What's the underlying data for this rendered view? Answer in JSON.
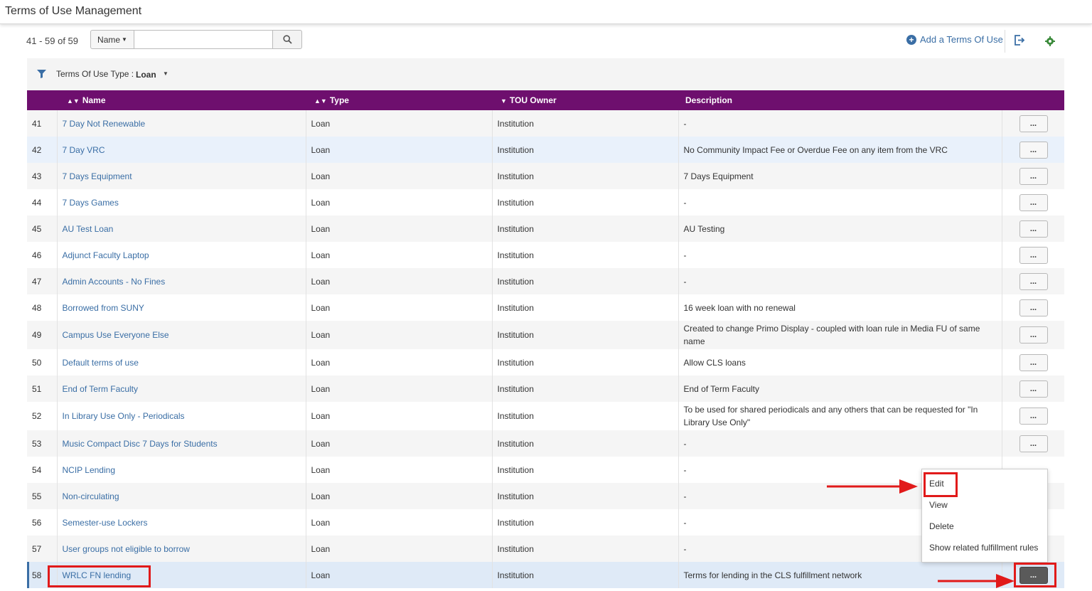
{
  "header": {
    "title": "Terms of Use Management"
  },
  "toolbar": {
    "count": "41 - 59 of 59",
    "scope_label": "Name",
    "search_value": "",
    "add_label": "Add a Terms Of Use"
  },
  "filter": {
    "label": "Terms Of Use Type :",
    "value": "Loan"
  },
  "columns": {
    "name": "Name",
    "type": "Type",
    "owner": "TOU Owner",
    "description": "Description"
  },
  "rows": [
    {
      "num": "41",
      "name": "7 Day Not Renewable",
      "type": "Loan",
      "owner": "Institution",
      "desc": "-"
    },
    {
      "num": "42",
      "name": "7 Day VRC",
      "type": "Loan",
      "owner": "Institution",
      "desc": "No Community Impact Fee or Overdue Fee on any item from the VRC"
    },
    {
      "num": "43",
      "name": "7 Days Equipment",
      "type": "Loan",
      "owner": "Institution",
      "desc": "7 Days Equipment"
    },
    {
      "num": "44",
      "name": "7 Days Games",
      "type": "Loan",
      "owner": "Institution",
      "desc": "-"
    },
    {
      "num": "45",
      "name": "AU Test Loan",
      "type": "Loan",
      "owner": "Institution",
      "desc": "AU Testing"
    },
    {
      "num": "46",
      "name": "Adjunct Faculty Laptop",
      "type": "Loan",
      "owner": "Institution",
      "desc": "-"
    },
    {
      "num": "47",
      "name": "Admin Accounts - No Fines",
      "type": "Loan",
      "owner": "Institution",
      "desc": "-"
    },
    {
      "num": "48",
      "name": "Borrowed from SUNY",
      "type": "Loan",
      "owner": "Institution",
      "desc": "16 week loan with no renewal"
    },
    {
      "num": "49",
      "name": "Campus Use Everyone Else",
      "type": "Loan",
      "owner": "Institution",
      "desc": "Created to change Primo Display - coupled with loan rule in Media FU of same name"
    },
    {
      "num": "50",
      "name": "Default terms of use",
      "type": "Loan",
      "owner": "Institution",
      "desc": "Allow CLS loans"
    },
    {
      "num": "51",
      "name": "End of Term Faculty",
      "type": "Loan",
      "owner": "Institution",
      "desc": "End of Term Faculty"
    },
    {
      "num": "52",
      "name": "In Library Use Only - Periodicals",
      "type": "Loan",
      "owner": "Institution",
      "desc": "To be used for shared periodicals and any others that can be requested for \"In Library Use Only\""
    },
    {
      "num": "53",
      "name": "Music Compact Disc 7 Days for Students",
      "type": "Loan",
      "owner": "Institution",
      "desc": "-"
    },
    {
      "num": "54",
      "name": "NCIP Lending",
      "type": "Loan",
      "owner": "Institution",
      "desc": "-"
    },
    {
      "num": "55",
      "name": "Non-circulating",
      "type": "Loan",
      "owner": "Institution",
      "desc": "-"
    },
    {
      "num": "56",
      "name": "Semester-use Lockers",
      "type": "Loan",
      "owner": "Institution",
      "desc": "-"
    },
    {
      "num": "57",
      "name": "User groups not eligible to borrow",
      "type": "Loan",
      "owner": "Institution",
      "desc": "-"
    },
    {
      "num": "58",
      "name": "WRLC FN lending",
      "type": "Loan",
      "owner": "Institution",
      "desc": "Terms for lending in the CLS fulfillment network"
    }
  ],
  "actions_label": "...",
  "row_menu": {
    "items": [
      "Edit",
      "View",
      "Delete",
      "Show related fulfillment rules"
    ]
  },
  "colors": {
    "header_bg": "#6e0f6e",
    "link": "#3a6ea5",
    "annotation": "#e11a1a"
  },
  "icons": [
    "search-icon",
    "plus-circle-icon",
    "export-icon",
    "gear-icon",
    "funnel-icon",
    "sort-icon",
    "caret-down-icon"
  ]
}
